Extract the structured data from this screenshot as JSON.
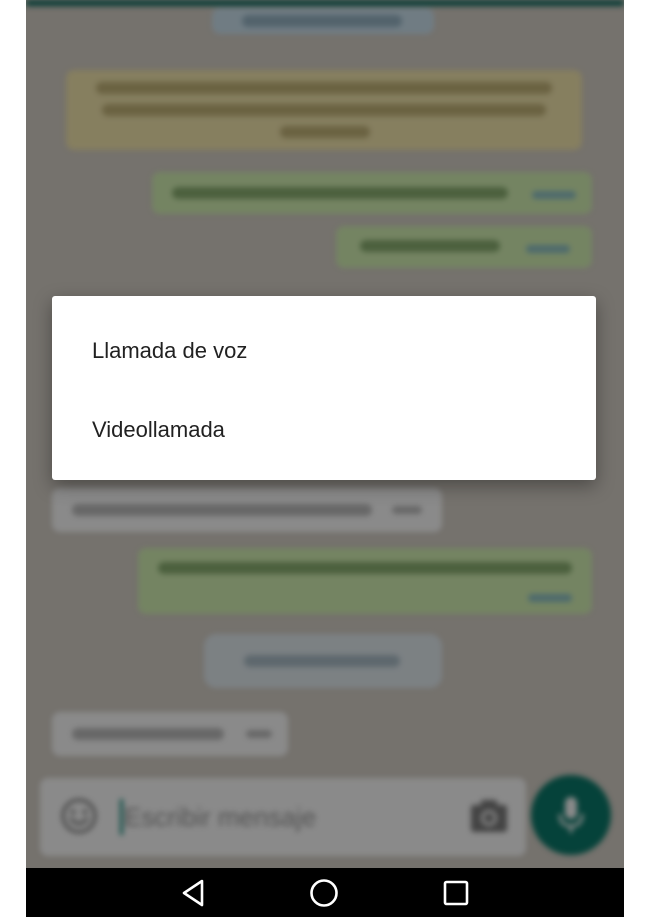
{
  "dialog": {
    "options": [
      {
        "label": "Llamada de voz"
      },
      {
        "label": "Videollamada"
      }
    ]
  },
  "composer": {
    "placeholder": "Escribir mensaje",
    "icons": {
      "emoji": "smiley-icon",
      "camera": "camera-icon",
      "mic": "microphone-icon"
    }
  },
  "navigation": {
    "icons": [
      "back-triangle-icon",
      "home-circle-icon",
      "recents-square-icon"
    ]
  },
  "colors": {
    "accent": "#0a7a6b",
    "outgoing_bubble": "#d7f4b6",
    "system_note": "#f7eab0"
  }
}
